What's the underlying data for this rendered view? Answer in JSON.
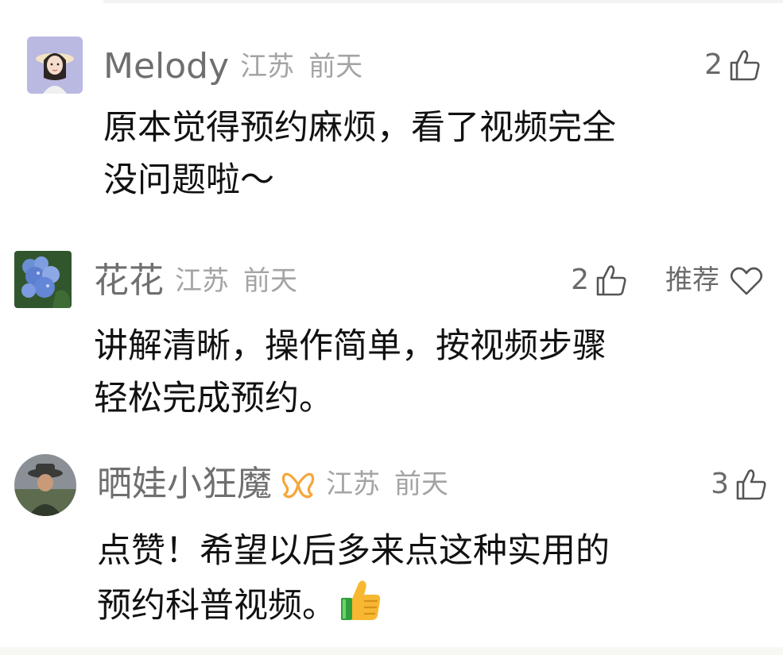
{
  "comments": [
    {
      "user": "Melody",
      "location": "江苏",
      "time": "前天",
      "likes": "2",
      "lines": [
        "原本觉得预约麻烦，看了视频完全",
        "没问题啦～"
      ],
      "avatar_icon": "cartoon-girl-avatar-icon"
    },
    {
      "user": "花花",
      "location": "江苏",
      "time": "前天",
      "likes": "2",
      "recommend": "推荐",
      "lines": [
        "讲解清晰，操作简单，按视频步骤",
        "轻松完成预约。"
      ],
      "avatar_icon": "hydrangea-flower-avatar-icon"
    },
    {
      "user": "晒娃小狂魔",
      "location": "江苏",
      "time": "前天",
      "likes": "3",
      "lines": [
        "点赞！希望以后多来点这种实用的",
        "预约科普视频。"
      ],
      "avatar_icon": "man-with-hat-avatar-icon",
      "badge_icon": "vip-butterfly-badge-icon",
      "emoji_icon": "thumbs-up-emoji-icon"
    }
  ],
  "colors": {
    "username": "#6f6f6f",
    "meta": "#a4a4a4",
    "content": "#111111",
    "badge": "#f5a63b"
  }
}
